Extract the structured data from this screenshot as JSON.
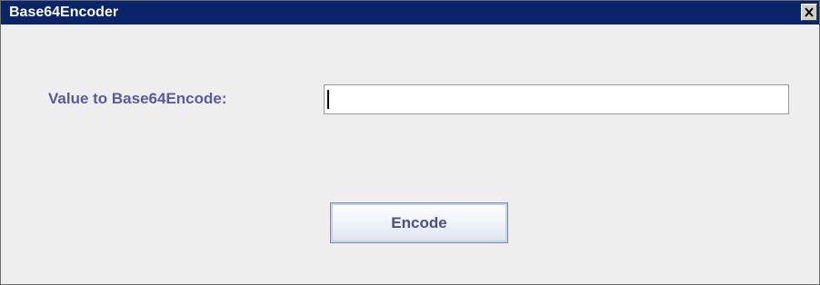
{
  "window": {
    "title": "Base64Encoder",
    "close_glyph": "close-icon",
    "titlebar_color": "#0a246a"
  },
  "form": {
    "label": "Value to Base64Encode:",
    "input_value": "",
    "input_placeholder": "",
    "label_color": "#5a5a9c"
  },
  "actions": {
    "encode_label": "Encode"
  }
}
